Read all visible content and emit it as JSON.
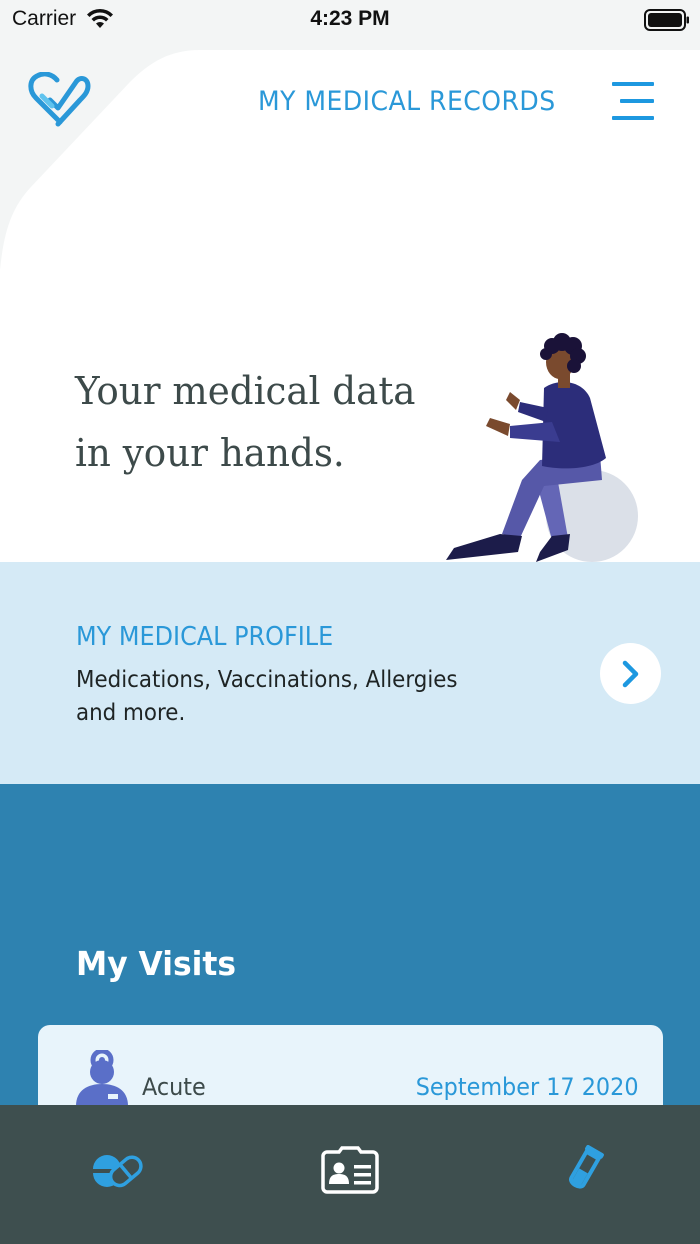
{
  "status_bar": {
    "carrier": "Carrier",
    "time": "4:23 PM"
  },
  "header": {
    "title": "MY MEDICAL RECORDS",
    "logo_icon": "heart-logo-icon",
    "menu_icon": "hamburger-menu-icon"
  },
  "hero": {
    "line1": "Your medical data",
    "line2": "in your hands."
  },
  "profile": {
    "title": "MY MEDICAL PROFILE",
    "description": "Medications, Vaccinations, Allergies and more.",
    "arrow_icon": "chevron-right-icon"
  },
  "visits": {
    "title": "My Visits",
    "items": [
      {
        "type": "Acute",
        "date": "September 17 2020",
        "icon": "doctor-icon"
      }
    ]
  },
  "tab_bar": {
    "tabs": [
      {
        "icon": "pills-icon",
        "active": false
      },
      {
        "icon": "id-card-icon",
        "active": true
      },
      {
        "icon": "test-tube-icon",
        "active": false
      }
    ]
  },
  "colors": {
    "accent": "#2a98d8",
    "profile_band": "#d5eaf6",
    "visits_band": "#2e82b0",
    "tab_bar": "#3e4f4f"
  }
}
